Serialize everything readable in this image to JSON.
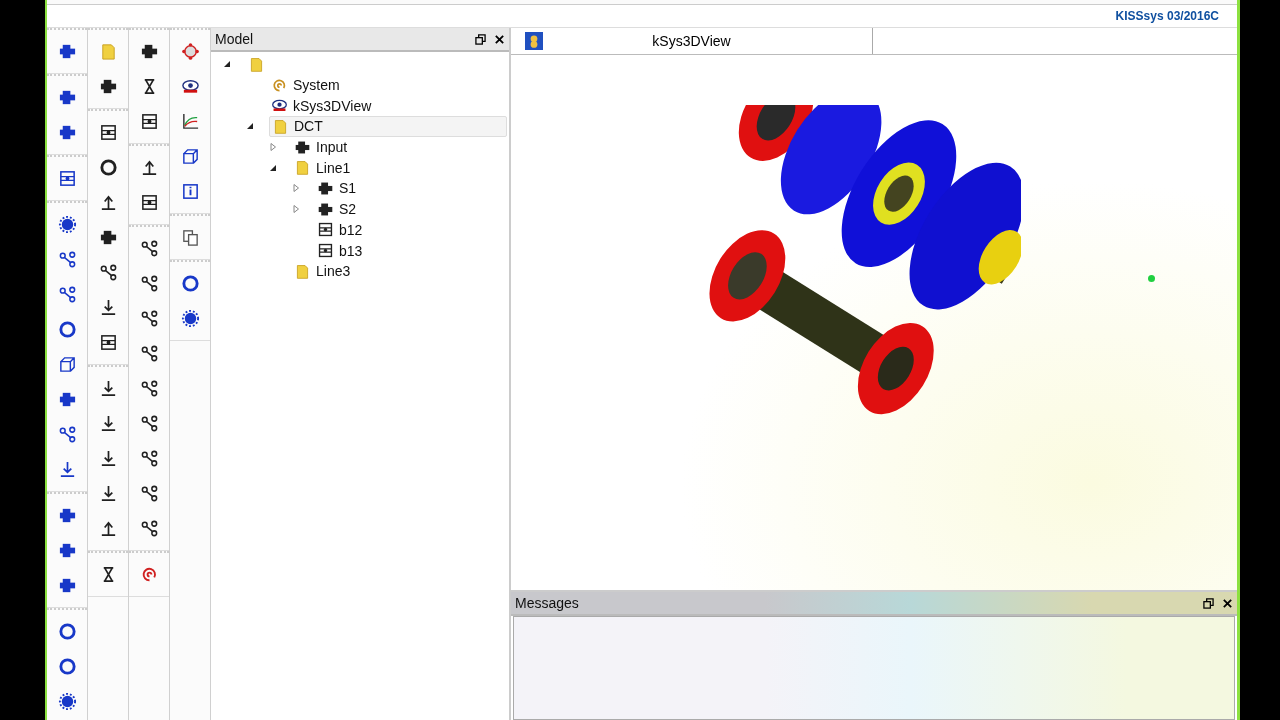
{
  "app": {
    "version_label": "KISSsys 03/2016C"
  },
  "model_panel": {
    "title": "Model",
    "tree": [
      {
        "kind": "root",
        "expanded": true,
        "selected": false,
        "children": [
          {
            "kind": "system",
            "label": "System",
            "selected": false
          },
          {
            "kind": "view",
            "label": "kSys3DView",
            "selected": false
          },
          {
            "kind": "assembly",
            "label": "DCT",
            "expanded": true,
            "selected": true,
            "children": [
              {
                "kind": "coupling",
                "label": "Input",
                "expanded": false,
                "selected": false
              },
              {
                "kind": "folder",
                "label": "Line1",
                "expanded": true,
                "selected": false,
                "children": [
                  {
                    "kind": "shaft",
                    "label": "S1",
                    "expanded": false,
                    "selected": false
                  },
                  {
                    "kind": "shaft",
                    "label": "S2",
                    "expanded": false,
                    "selected": false
                  },
                  {
                    "kind": "bearing",
                    "label": "b12",
                    "selected": false
                  },
                  {
                    "kind": "bearing",
                    "label": "b13",
                    "selected": false
                  }
                ]
              },
              {
                "kind": "folder",
                "label": "Line3",
                "selected": false
              }
            ]
          }
        ]
      }
    ]
  },
  "view_tabs": [
    {
      "label": "kSys3DView",
      "selected": true
    }
  ],
  "messages_panel": {
    "title": "Messages"
  }
}
